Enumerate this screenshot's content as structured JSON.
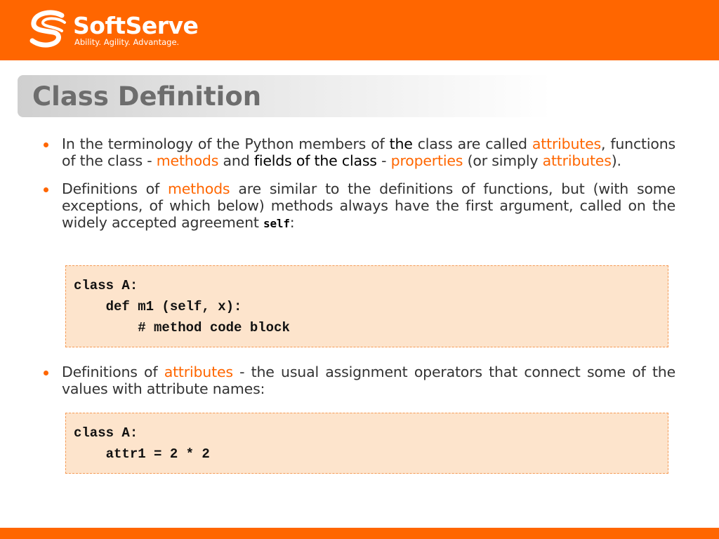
{
  "brand": {
    "name": "SoftServe",
    "tagline": "Ability. Agility. Advantage.",
    "color": "#ff6600"
  },
  "title": "Class Definition",
  "bullets": [
    {
      "segments": [
        {
          "t": "In the terminology of the Python members of ",
          "s": ""
        },
        {
          "t": "the",
          "s": "dk"
        },
        {
          "t": " class are called ",
          "s": ""
        },
        {
          "t": "attributes",
          "s": "hl"
        },
        {
          "t": ", functions of the class - ",
          "s": ""
        },
        {
          "t": "methods",
          "s": "hl"
        },
        {
          "t": " and ",
          "s": ""
        },
        {
          "t": "fields of the class",
          "s": "dk"
        },
        {
          "t": " - ",
          "s": ""
        },
        {
          "t": "properties",
          "s": "hl"
        },
        {
          "t": " (or simply ",
          "s": ""
        },
        {
          "t": "attributes",
          "s": "hl"
        },
        {
          "t": ").",
          "s": ""
        }
      ]
    },
    {
      "segments": [
        {
          "t": "Definitions of ",
          "s": ""
        },
        {
          "t": "methods",
          "s": "hl"
        },
        {
          "t": " are similar to the definitions of functions, but (with some exceptions, of which below) methods always have the first argument, called on the widely accepted agreement ",
          "s": ""
        },
        {
          "t": "self",
          "s": "mono"
        },
        {
          "t": ":",
          "s": ""
        }
      ]
    },
    {
      "segments": [
        {
          "t": "Definitions of ",
          "s": ""
        },
        {
          "t": "attributes",
          "s": "hl"
        },
        {
          "t": " - the usual assignment operators that connect some of the values with attribute names:",
          "s": ""
        }
      ]
    }
  ],
  "code_blocks": [
    "class A:\n    def m1 (self, x):\n        # method code block",
    "class A:\n    attr1 = 2 * 2"
  ]
}
